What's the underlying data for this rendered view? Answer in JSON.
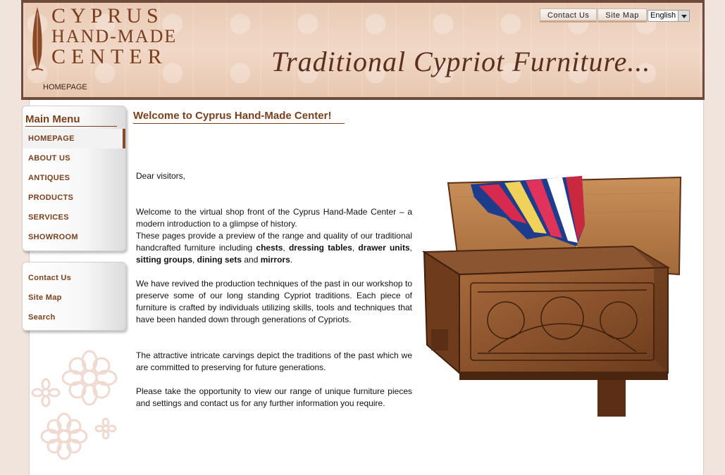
{
  "header": {
    "logo": {
      "line1": "CYPRUS",
      "line2": "HAND-MADE",
      "line3": "CENTER"
    },
    "tagline": "Traditional Cypriot Furniture...",
    "breadcrumb": "HOMEPAGE",
    "top_links": [
      "Contact Us",
      "Site Map"
    ],
    "language": "English"
  },
  "main_menu": {
    "title": "Main Menu",
    "items": [
      {
        "label": "HOMEPAGE",
        "active": true
      },
      {
        "label": "ABOUT US"
      },
      {
        "label": "ANTIQUES"
      },
      {
        "label": "PRODUCTS"
      },
      {
        "label": "SERVICES"
      },
      {
        "label": "SHOWROOM"
      }
    ]
  },
  "secondary_menu": {
    "items": [
      "Contact Us",
      "Site Map",
      "Search"
    ]
  },
  "content": {
    "title": "Welcome to Cyprus Hand-Made Center!",
    "greeting": "Dear visitors,",
    "p1_a": "Welcome to the virtual shop front of the Cyprus Hand-Made Center – a modern introduction to a glimpse of history.",
    "p1_b": "These pages provide a preview of the range and quality of our traditional handcrafted furniture including ",
    "kw_chests": "chests",
    "kw_dressing": "dressing tables",
    "kw_drawer": "drawer units",
    "kw_sitting": "sitting groups",
    "kw_dining": "dining sets",
    "kw_mirrors": "mirrors",
    "p2": "We have revived the production techniques of the past in our workshop to preserve some of our long standing Cypriot traditions. Each piece of furniture is crafted by individuals utilizing skills, tools and techniques that have been handed down through generations of Cypriots.",
    "p3": "The attractive intricate carvings depict the traditions of the past which we are committed to preserving for future generations.",
    "p4": "Please take the opportunity to view our range of unique furniture pieces and settings and contact us for any further information you require."
  },
  "colors": {
    "brand_brown": "#7a3f1c",
    "header_border": "#6d4a3c",
    "page_bg": "#f1e4dc"
  }
}
